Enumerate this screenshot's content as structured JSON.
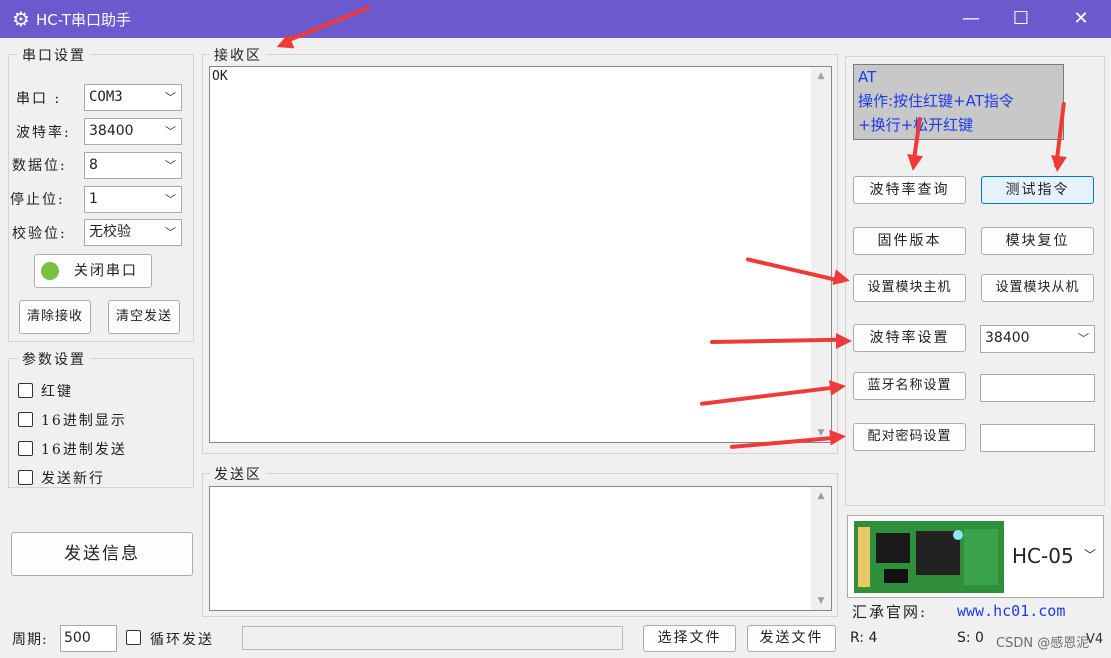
{
  "window": {
    "title": "HC-T串口助手",
    "minimize": "—",
    "maximize": "☐",
    "close": "✕"
  },
  "serial_settings": {
    "group_label": "串口设置",
    "port_label": "串口  :",
    "port_value": "COM3",
    "baud_label": "波特率:",
    "baud_value": "38400",
    "data_bits_label": "数据位:",
    "data_bits_value": "8",
    "stop_bits_label": "停止位:",
    "stop_bits_value": "1",
    "parity_label": "校验位:",
    "parity_value": "无校验",
    "close_port_label": "关闭串口",
    "clear_receive_label": "清除接收",
    "clear_send_label": "清空发送",
    "status_color": "#7ac143"
  },
  "param_settings": {
    "group_label": "参数设置",
    "red_key": "红键",
    "hex_display": "16进制显示",
    "hex_send": "16进制发送",
    "send_newline": "发送新行"
  },
  "send_info_label": "发送信息",
  "receive": {
    "label": "接收区",
    "content": "OK"
  },
  "send": {
    "label": "发送区"
  },
  "right_panel": {
    "info_lines": [
      "AT",
      "操作:按住红键+AT指令",
      "+换行+松开红键"
    ],
    "info_color": "#1d3be8",
    "baud_query": "波特率查询",
    "test_cmd": "测试指令",
    "firmware": "固件版本",
    "reset": "模块复位",
    "set_master": "设置模块主机",
    "set_slave": "设置模块从机",
    "baud_set": "波特率设置",
    "baud_set_value": "38400",
    "bt_name_set": "蓝牙名称设置",
    "pair_pwd_set": "配对密码设置",
    "module_name": "HC-05",
    "site_label": "汇承官网:",
    "site_url": "www.hc01.com",
    "site_color": "#1d3be8"
  },
  "bottom": {
    "period_label": "周期:",
    "period_value": "500",
    "loop_send": "循环发送",
    "choose_file": "选择文件",
    "send_file": "发送文件",
    "r_count": "R: 4",
    "s_count": "S: 0",
    "watermark": "CSDN @感恩泥",
    "version": "V4"
  }
}
